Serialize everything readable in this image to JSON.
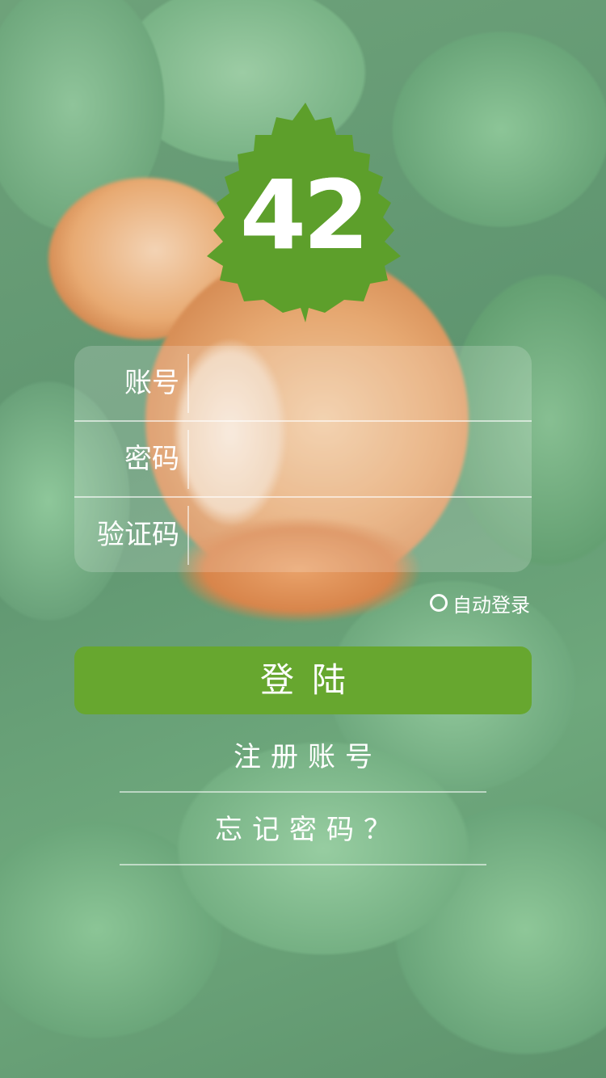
{
  "logo": {
    "number": "42",
    "leaf_color": "#5d9f2b"
  },
  "form": {
    "account_label": "账号",
    "password_label": "密码",
    "captcha_label": "验证码",
    "account_value": "",
    "password_value": "",
    "captcha_value": ""
  },
  "auto_login": {
    "label": "自动登录",
    "checked": false
  },
  "login_button": {
    "label": "登陆",
    "color": "#67a72f"
  },
  "links": {
    "register": "注册账号",
    "forgot_password": "忘记密码？"
  }
}
